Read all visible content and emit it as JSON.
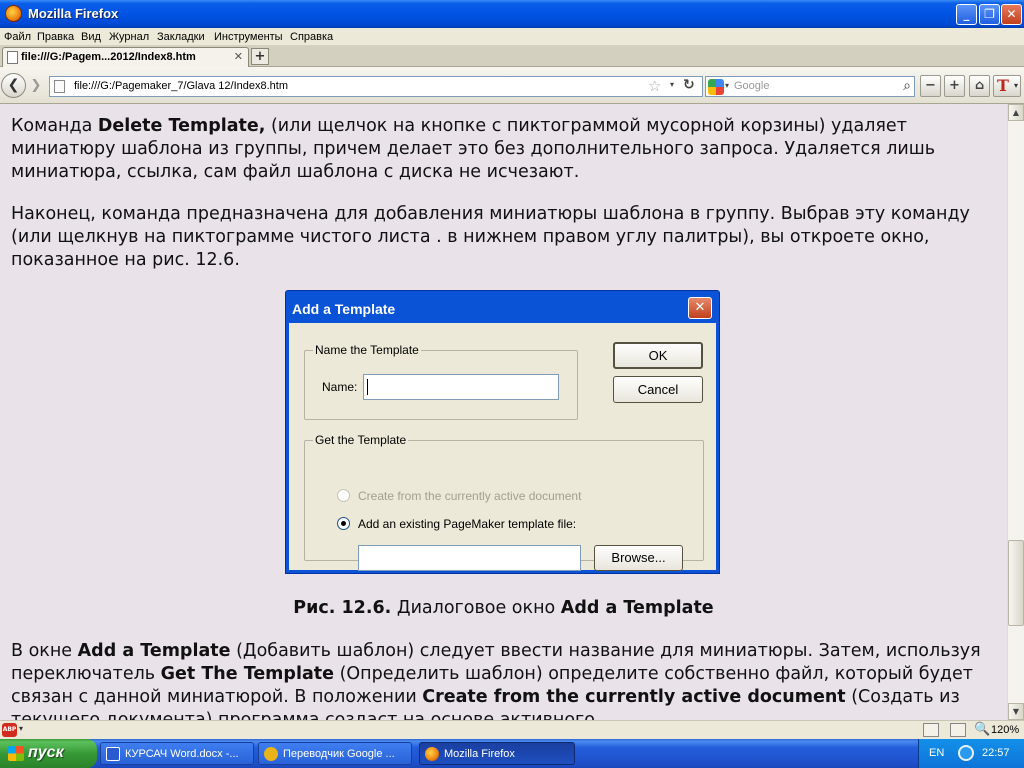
{
  "window": {
    "title": "Mozilla Firefox",
    "minimize": "_",
    "maximize": "❐",
    "close": "✕"
  },
  "menu": [
    "Файл",
    "Правка",
    "Вид",
    "Журнал",
    "Закладки",
    "Инструменты",
    "Справка"
  ],
  "tab": {
    "label": "file:///G:/Pagem...2012/Index8.htm",
    "close": "✕",
    "new_tab": "+"
  },
  "nav": {
    "back": "❮",
    "forward": "❯",
    "url": "file:///G:/Pagemaker_7/Glava 12/Index8.htm",
    "bookmark_star": "☆",
    "dropdown": "▾",
    "reload": "↻",
    "search_placeholder": "Google",
    "search_dropdown": "▾",
    "search_glass": "⌕",
    "zoom_out": "−",
    "zoom_in": "+",
    "home": "⌂",
    "text_style": "T",
    "text_style_arrow": "▾"
  },
  "content": {
    "p1_cmd": "Команда ",
    "p1_bold": "Delete Template,",
    "p1_rest": " (или щелчок на кнопке с пиктограммой мусорной корзины) удаляет миниатюру шаблона из группы, причем делает это без дополнительного запроса. Удаляется лишь миниатюра, ссылка, сам файл шаблона с диска не исчезают.",
    "p2": "Наконец, команда предназначена для добавления миниатюры шаблона в группу. Выбрав эту команду (или щелкнув на пиктограмме чистого листа . в нижнем правом углу палитры), вы откроете окно, показанное на рис. 12.6.",
    "caption_bold1": "Рис. 12.6.",
    "caption_mid": " Диалоговое окно ",
    "caption_bold2": "Add a Template",
    "p4_a": "В окне ",
    "p4_b": "Add a Template",
    "p4_c": " (Добавить шаблон) следует ввести название для миниатюры. Затем, используя переключатель ",
    "p4_d": "Get The Template",
    "p4_e": " (Определить шаблон) определите собственно файл, который будет связан с данной миниатюрой. В положении ",
    "p4_f": "Create from the currently active document",
    "p4_g": " (Создать из текущего документа) программа создаст на основе активного"
  },
  "dialog": {
    "title": "Add a Template",
    "close": "✕",
    "group1": "Name the Template",
    "name_label": "Name:",
    "ok": "OK",
    "cancel": "Cancel",
    "group2": "Get the Template",
    "radio1": "Create from the currently active document",
    "radio2": "Add an existing PageMaker template file:",
    "browse": "Browse..."
  },
  "scrollbar": {
    "up": "▲",
    "down": "▼"
  },
  "status": {
    "adblock": "ABP",
    "adblock_drop": "▾",
    "zoom_glass": "🔍",
    "zoom": "120%"
  },
  "taskbar": {
    "start": "пуск",
    "tasks": [
      "КУРСАЧ Word.docx -...",
      "Переводчик Google ...",
      "Mozilla Firefox"
    ],
    "lang": "EN",
    "clock": "22:57"
  }
}
